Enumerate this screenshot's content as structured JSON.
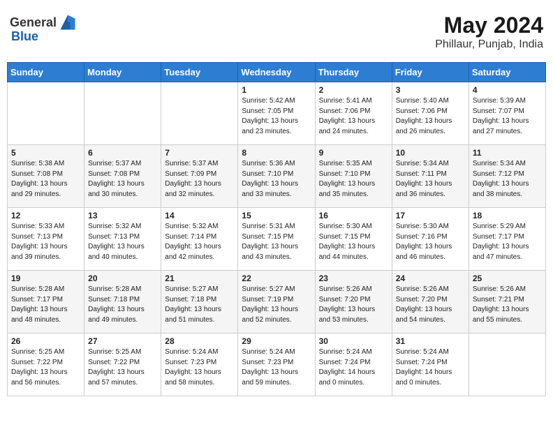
{
  "header": {
    "logo_general": "General",
    "logo_blue": "Blue",
    "title": "May 2024",
    "location": "Phillaur, Punjab, India"
  },
  "weekdays": [
    "Sunday",
    "Monday",
    "Tuesday",
    "Wednesday",
    "Thursday",
    "Friday",
    "Saturday"
  ],
  "weeks": [
    [
      {
        "day": "",
        "info": ""
      },
      {
        "day": "",
        "info": ""
      },
      {
        "day": "",
        "info": ""
      },
      {
        "day": "1",
        "info": "Sunrise: 5:42 AM\nSunset: 7:05 PM\nDaylight: 13 hours\nand 23 minutes."
      },
      {
        "day": "2",
        "info": "Sunrise: 5:41 AM\nSunset: 7:06 PM\nDaylight: 13 hours\nand 24 minutes."
      },
      {
        "day": "3",
        "info": "Sunrise: 5:40 AM\nSunset: 7:06 PM\nDaylight: 13 hours\nand 26 minutes."
      },
      {
        "day": "4",
        "info": "Sunrise: 5:39 AM\nSunset: 7:07 PM\nDaylight: 13 hours\nand 27 minutes."
      }
    ],
    [
      {
        "day": "5",
        "info": "Sunrise: 5:38 AM\nSunset: 7:08 PM\nDaylight: 13 hours\nand 29 minutes."
      },
      {
        "day": "6",
        "info": "Sunrise: 5:37 AM\nSunset: 7:08 PM\nDaylight: 13 hours\nand 30 minutes."
      },
      {
        "day": "7",
        "info": "Sunrise: 5:37 AM\nSunset: 7:09 PM\nDaylight: 13 hours\nand 32 minutes."
      },
      {
        "day": "8",
        "info": "Sunrise: 5:36 AM\nSunset: 7:10 PM\nDaylight: 13 hours\nand 33 minutes."
      },
      {
        "day": "9",
        "info": "Sunrise: 5:35 AM\nSunset: 7:10 PM\nDaylight: 13 hours\nand 35 minutes."
      },
      {
        "day": "10",
        "info": "Sunrise: 5:34 AM\nSunset: 7:11 PM\nDaylight: 13 hours\nand 36 minutes."
      },
      {
        "day": "11",
        "info": "Sunrise: 5:34 AM\nSunset: 7:12 PM\nDaylight: 13 hours\nand 38 minutes."
      }
    ],
    [
      {
        "day": "12",
        "info": "Sunrise: 5:33 AM\nSunset: 7:13 PM\nDaylight: 13 hours\nand 39 minutes."
      },
      {
        "day": "13",
        "info": "Sunrise: 5:32 AM\nSunset: 7:13 PM\nDaylight: 13 hours\nand 40 minutes."
      },
      {
        "day": "14",
        "info": "Sunrise: 5:32 AM\nSunset: 7:14 PM\nDaylight: 13 hours\nand 42 minutes."
      },
      {
        "day": "15",
        "info": "Sunrise: 5:31 AM\nSunset: 7:15 PM\nDaylight: 13 hours\nand 43 minutes."
      },
      {
        "day": "16",
        "info": "Sunrise: 5:30 AM\nSunset: 7:15 PM\nDaylight: 13 hours\nand 44 minutes."
      },
      {
        "day": "17",
        "info": "Sunrise: 5:30 AM\nSunset: 7:16 PM\nDaylight: 13 hours\nand 46 minutes."
      },
      {
        "day": "18",
        "info": "Sunrise: 5:29 AM\nSunset: 7:17 PM\nDaylight: 13 hours\nand 47 minutes."
      }
    ],
    [
      {
        "day": "19",
        "info": "Sunrise: 5:28 AM\nSunset: 7:17 PM\nDaylight: 13 hours\nand 48 minutes."
      },
      {
        "day": "20",
        "info": "Sunrise: 5:28 AM\nSunset: 7:18 PM\nDaylight: 13 hours\nand 49 minutes."
      },
      {
        "day": "21",
        "info": "Sunrise: 5:27 AM\nSunset: 7:18 PM\nDaylight: 13 hours\nand 51 minutes."
      },
      {
        "day": "22",
        "info": "Sunrise: 5:27 AM\nSunset: 7:19 PM\nDaylight: 13 hours\nand 52 minutes."
      },
      {
        "day": "23",
        "info": "Sunrise: 5:26 AM\nSunset: 7:20 PM\nDaylight: 13 hours\nand 53 minutes."
      },
      {
        "day": "24",
        "info": "Sunrise: 5:26 AM\nSunset: 7:20 PM\nDaylight: 13 hours\nand 54 minutes."
      },
      {
        "day": "25",
        "info": "Sunrise: 5:26 AM\nSunset: 7:21 PM\nDaylight: 13 hours\nand 55 minutes."
      }
    ],
    [
      {
        "day": "26",
        "info": "Sunrise: 5:25 AM\nSunset: 7:22 PM\nDaylight: 13 hours\nand 56 minutes."
      },
      {
        "day": "27",
        "info": "Sunrise: 5:25 AM\nSunset: 7:22 PM\nDaylight: 13 hours\nand 57 minutes."
      },
      {
        "day": "28",
        "info": "Sunrise: 5:24 AM\nSunset: 7:23 PM\nDaylight: 13 hours\nand 58 minutes."
      },
      {
        "day": "29",
        "info": "Sunrise: 5:24 AM\nSunset: 7:23 PM\nDaylight: 13 hours\nand 59 minutes."
      },
      {
        "day": "30",
        "info": "Sunrise: 5:24 AM\nSunset: 7:24 PM\nDaylight: 14 hours\nand 0 minutes."
      },
      {
        "day": "31",
        "info": "Sunrise: 5:24 AM\nSunset: 7:24 PM\nDaylight: 14 hours\nand 0 minutes."
      },
      {
        "day": "",
        "info": ""
      }
    ]
  ]
}
